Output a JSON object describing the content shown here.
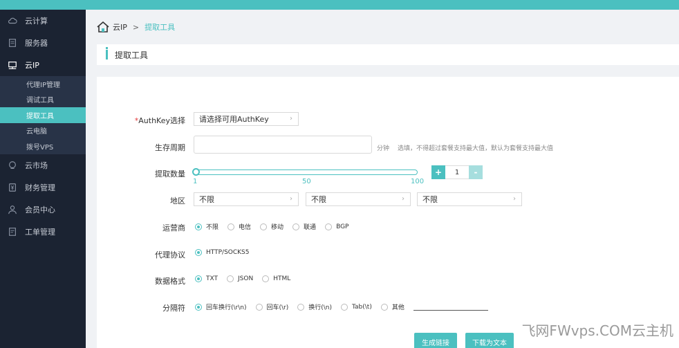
{
  "sidebar": {
    "items": [
      {
        "label": "云计算",
        "icon": "cloud-icon"
      },
      {
        "label": "服务器",
        "icon": "server-icon"
      },
      {
        "label": "云IP",
        "icon": "monitor-icon"
      },
      {
        "label": "云市场",
        "icon": "market-icon"
      },
      {
        "label": "财务管理",
        "icon": "finance-icon"
      },
      {
        "label": "会员中心",
        "icon": "user-icon"
      },
      {
        "label": "工单管理",
        "icon": "ticket-icon"
      }
    ],
    "submenu": [
      {
        "label": "代理IP管理"
      },
      {
        "label": "调试工具"
      },
      {
        "label": "提取工具"
      },
      {
        "label": "云电脑"
      },
      {
        "label": "拨号VPS"
      }
    ]
  },
  "breadcrumb": {
    "root": "云IP",
    "separator": ">",
    "current": "提取工具"
  },
  "page": {
    "title": "提取工具"
  },
  "form": {
    "authkey": {
      "required_mark": "*",
      "label": "AuthKey选择",
      "placeholder": "请选择可用AuthKey"
    },
    "lifetime": {
      "label": "生存周期",
      "unit": "分钟",
      "hint": "选填，不得超过套餐支持最大值，默认为套餐支持最大值",
      "value": ""
    },
    "quantity": {
      "label": "提取数量",
      "min": "1",
      "mid": "50",
      "max": "100",
      "value": "1",
      "plus": "+",
      "minus": "-"
    },
    "region": {
      "label": "地区",
      "selects": [
        "不限",
        "不限",
        "不限"
      ]
    },
    "carrier": {
      "label": "运营商",
      "options": [
        "不限",
        "电信",
        "移动",
        "联通",
        "BGP"
      ],
      "selected": 0
    },
    "protocol": {
      "label": "代理协议",
      "options": [
        "HTTP/SOCKS5"
      ],
      "selected": 0
    },
    "format": {
      "label": "数据格式",
      "options": [
        "TXT",
        "JSON",
        "HTML"
      ],
      "selected": 0
    },
    "separator": {
      "label": "分隔符",
      "options": [
        "回车换行(\\r\\n)",
        "回车(\\r)",
        "换行(\\n)",
        "Tab(\\t)",
        "其他"
      ],
      "selected": 0
    }
  },
  "buttons": {
    "generate": "生成链接",
    "download": "下载为文本"
  },
  "watermark": "飞网FWvps.COM云主机",
  "colors": {
    "accent": "#4bc0c0",
    "sidebar": "#1b2332",
    "submenu": "#283347"
  }
}
